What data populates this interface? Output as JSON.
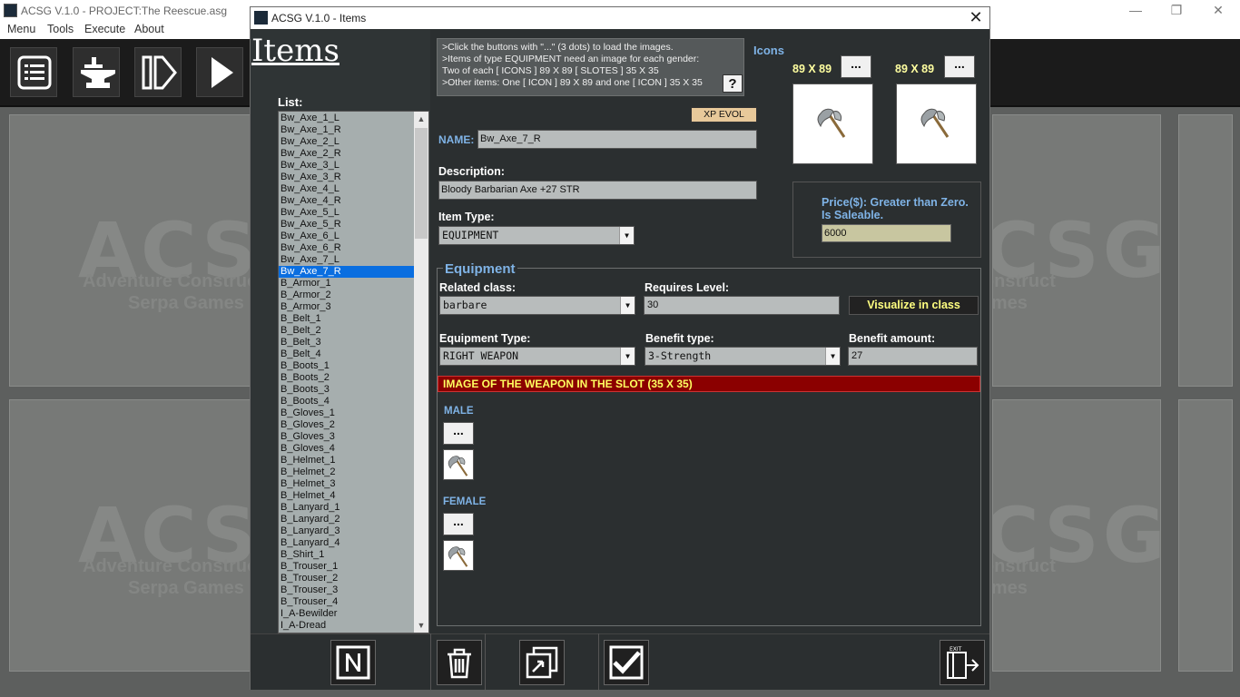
{
  "app": {
    "title": "ACSG V.1.0 - PROJECT:The Reescue.asg",
    "menu": [
      "Menu",
      "Tools",
      "Execute",
      "About"
    ],
    "logo": "ACSG",
    "logo_sub1": "Adventure Construct",
    "logo_sub2": "Serpa Games"
  },
  "dialog": {
    "title": "ACSG V.1.0 - Items",
    "heading": "Items",
    "list_label": "List:",
    "list": [
      "Bw_Axe_1_L",
      "Bw_Axe_1_R",
      "Bw_Axe_2_L",
      "Bw_Axe_2_R",
      "Bw_Axe_3_L",
      "Bw_Axe_3_R",
      "Bw_Axe_4_L",
      "Bw_Axe_4_R",
      "Bw_Axe_5_L",
      "Bw_Axe_5_R",
      "Bw_Axe_6_L",
      "Bw_Axe_6_R",
      "Bw_Axe_7_L",
      "Bw_Axe_7_R",
      "B_Armor_1",
      "B_Armor_2",
      "B_Armor_3",
      "B_Belt_1",
      "B_Belt_2",
      "B_Belt_3",
      "B_Belt_4",
      "B_Boots_1",
      "B_Boots_2",
      "B_Boots_3",
      "B_Boots_4",
      "B_Gloves_1",
      "B_Gloves_2",
      "B_Gloves_3",
      "B_Gloves_4",
      "B_Helmet_1",
      "B_Helmet_2",
      "B_Helmet_3",
      "B_Helmet_4",
      "B_Lanyard_1",
      "B_Lanyard_2",
      "B_Lanyard_3",
      "B_Lanyard_4",
      "B_Shirt_1",
      "B_Trouser_1",
      "B_Trouser_2",
      "B_Trouser_3",
      "B_Trouser_4",
      "I_A-Bewilder",
      "I_A-Dread"
    ],
    "selected_item": "Bw_Axe_7_R",
    "info": [
      ">Click the buttons with \"...\" (3 dots) to load the images.",
      ">Items of type EQUIPMENT need an image for each gender:",
      "Two of each [ ICONS ] 89 X 89 [ SLOTES ] 35 X 35",
      ">Other items: One [ ICON ] 89 X 89 and one [ ICON ] 35 X 35"
    ],
    "help_label": "?",
    "icons_label": "Icons",
    "icon_size": "89 X 89",
    "dots": "...",
    "xp_evol": "XP EVOL",
    "name_label": "NAME:",
    "name_value": "Bw_Axe_7_R",
    "desc_label": "Description:",
    "desc_value": "Bloody Barbarian Axe +27 STR",
    "type_label": "Item Type:",
    "type_value": "EQUIPMENT",
    "price_label": "Price($): Greater than Zero. Is Saleable.",
    "price_value": "6000",
    "equipment": {
      "title": "Equipment",
      "class_label": "Related class:",
      "class_value": "barbare",
      "level_label": "Requires Level:",
      "level_value": "30",
      "visualize": "Visualize in class",
      "equip_type_label": "Equipment Type:",
      "equip_type_value": "RIGHT WEAPON",
      "benefit_type_label": "Benefit type:",
      "benefit_type_value": "3-Strength",
      "benefit_amount_label": "Benefit amount:",
      "benefit_amount_value": "27",
      "slot_bar": "IMAGE OF THE WEAPON IN THE SLOT (35 X 35)",
      "male": "MALE",
      "female": "FEMALE"
    }
  }
}
